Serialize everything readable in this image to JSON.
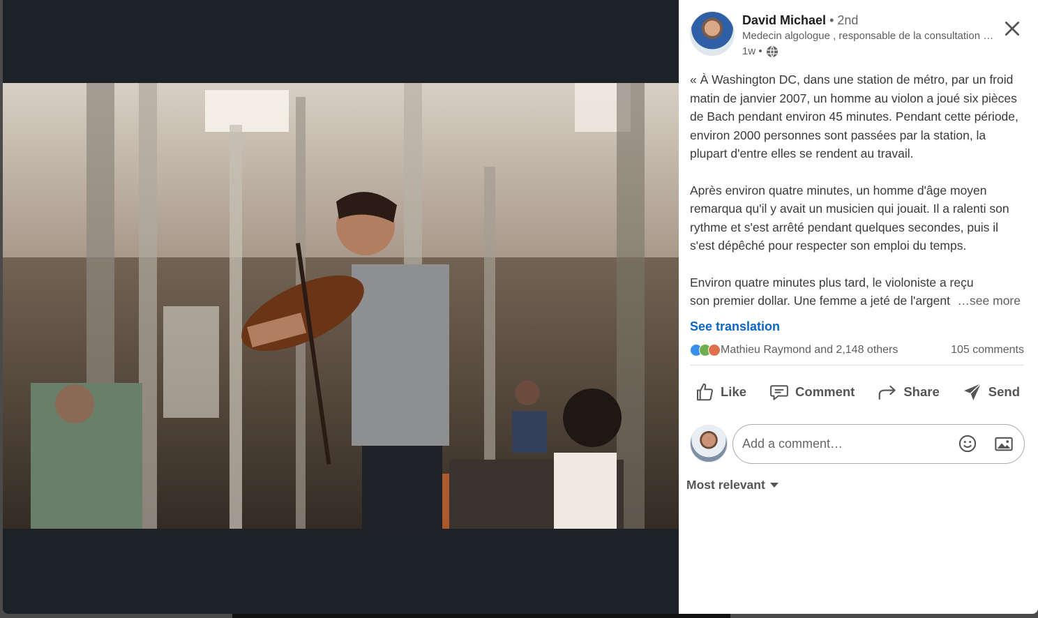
{
  "post": {
    "author": {
      "name": "David Michael",
      "degree": "• 2nd",
      "headline": "Medecin algologue , responsable de la consultation douleur",
      "time": "1w •",
      "globe_icon": "globe-icon"
    },
    "paragraphs": [
      "« À Washington DC, dans une station de métro, par un froid matin de janvier 2007, un homme au violon a joué six pièces de Bach pendant environ 45 minutes. Pendant cette période, environ 2000 personnes sont passées par la station, la plupart d'entre elles se rendent au travail.",
      "Après environ quatre minutes, un homme d'âge moyen remarqua qu'il y avait un musicien qui jouait. Il a ralenti son rythme et s'est arrêté pendant quelques secondes, puis il s'est dépêché pour respecter son emploi du temps."
    ],
    "truncated_line1": "Environ quatre minutes plus tard, le violoniste a reçu",
    "truncated_line2": "son premier dollar. Une femme a jeté de l'argent",
    "see_more": "…see more",
    "see_translation": "See translation",
    "reactions_text": "Mathieu Raymond and 2,148 others",
    "comments_count": "105 comments"
  },
  "actions": {
    "like": "Like",
    "comment": "Comment",
    "share": "Share",
    "send": "Send"
  },
  "comment_input": {
    "placeholder": "Add a comment…"
  },
  "sort": {
    "label": "Most relevant"
  },
  "colors": {
    "accent": "#0a66c2",
    "media_bg": "#1d2226"
  }
}
